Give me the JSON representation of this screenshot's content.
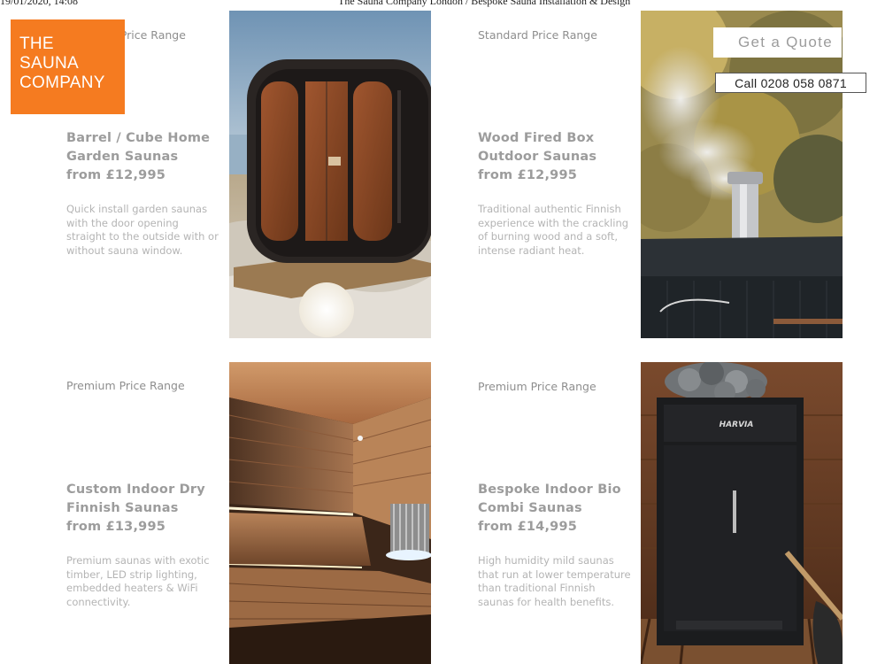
{
  "print_header": {
    "date": "19/01/2020, 14:08",
    "title": "The Sauna Company London / Bespoke Sauna Installation & Design"
  },
  "logo": {
    "line1": "THE",
    "line2": "SAUNA",
    "line3": "COMPANY"
  },
  "header_actions": {
    "quote_label": "Get a Quote",
    "call_label": "Call 0208 058 0871"
  },
  "products": [
    {
      "range": "Standard Price Range",
      "name_line1": "Barrel / Cube Home",
      "name_line2": "Garden Saunas",
      "price": "from £12,995",
      "description": "Quick install garden saunas with the door opening straight to the outside with or without sauna window."
    },
    {
      "range": "Standard Price Range",
      "name_line1": "Wood Fired Box",
      "name_line2": "Outdoor Saunas",
      "price": "from £12,995",
      "description": "Traditional authentic Finnish experience with the crackling of burning wood and a soft, intense radiant heat."
    },
    {
      "range": "Premium Price Range",
      "name_line1": "Custom Indoor Dry",
      "name_line2": "Finnish Saunas",
      "price": "from £13,995",
      "description": "Premium saunas with exotic timber, LED strip lighting, embedded heaters & WiFi connectivity."
    },
    {
      "range": "Premium Price Range",
      "name_line1": "Bespoke Indoor Bio",
      "name_line2": "Combi Saunas",
      "price": "from £14,995",
      "description": "High humidity mild saunas that run at lower temperature than traditional Finnish saunas for health benefits."
    }
  ],
  "heater_brand": "HARVIA",
  "colors": {
    "brand_orange": "#f57b20",
    "muted_text": "#9c9c9c"
  }
}
